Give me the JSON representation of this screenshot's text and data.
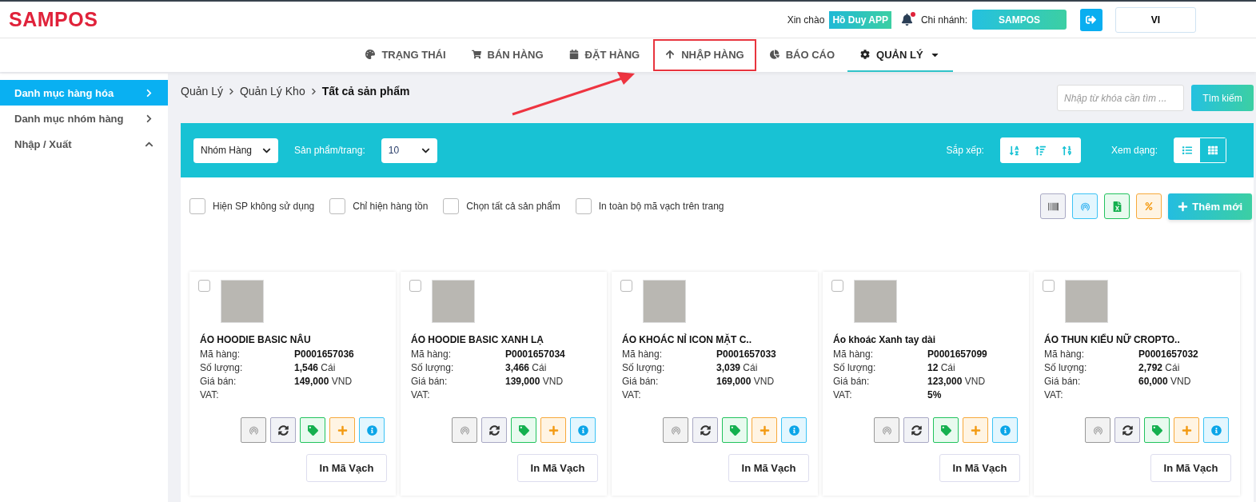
{
  "header": {
    "logo": "SAMPOS",
    "greeting": "Xin chào",
    "user": "Hồ Duy APP",
    "notifications": {
      "unread": true
    },
    "branch_label": "Chi nhánh:",
    "branch": "SAMPOS",
    "language": "VI"
  },
  "nav": [
    {
      "label": "TRẠNG THÁI",
      "selected": false,
      "highlighted": false,
      "dropdown": false
    },
    {
      "label": "BÁN HÀNG",
      "selected": false,
      "highlighted": false,
      "dropdown": false
    },
    {
      "label": "ĐẶT HÀNG",
      "selected": false,
      "highlighted": false,
      "dropdown": false
    },
    {
      "label": "NHẬP HÀNG",
      "selected": false,
      "highlighted": true,
      "dropdown": false
    },
    {
      "label": "BÁO CÁO",
      "selected": false,
      "highlighted": false,
      "dropdown": false
    },
    {
      "label": "QUẢN LÝ",
      "selected": true,
      "highlighted": false,
      "dropdown": true
    }
  ],
  "sidebar": {
    "items": [
      {
        "label": "Danh mục hàng hóa",
        "selected": true,
        "expanded": false
      },
      {
        "label": "Danh mục nhóm hàng",
        "selected": false,
        "expanded": false
      },
      {
        "label": "Nhập / Xuất",
        "selected": false,
        "expanded": true
      }
    ]
  },
  "breadcrumb": [
    "Quản Lý",
    "Quản Lý Kho",
    "Tất cả sản phẩm"
  ],
  "search": {
    "placeholder": "Nhập từ khóa cần tìm ...",
    "button": "Tìm kiếm"
  },
  "toolbar": {
    "group_select": "Nhóm Hàng",
    "per_page_label": "Sản phẩm/trang:",
    "per_page": "10",
    "sort_label": "Sắp xếp:",
    "view_label": "Xem dạng:",
    "view_modes": [
      {
        "kind": "list",
        "selected": false
      },
      {
        "kind": "grid",
        "selected": true
      }
    ]
  },
  "filters": [
    {
      "label": "Hiện SP không sử dụng",
      "checked": false
    },
    {
      "label": "Chỉ hiện hàng tồn",
      "checked": false
    },
    {
      "label": "Chọn tất cả sản phẩm",
      "checked": false
    },
    {
      "label": "In toàn bộ mã vạch trên trang",
      "checked": false
    }
  ],
  "add_button": "Thêm mới",
  "products": [
    {
      "name": "ÁO HOODIE BASIC NÂU",
      "checked": false,
      "fields": [
        {
          "label": "Mã hàng:",
          "value": "**P0001657036**"
        },
        {
          "label": "Số lượng:",
          "value": "**1,546** Cái"
        },
        {
          "label": "Giá bán:",
          "value": "**149,000** VND"
        },
        {
          "label": "VAT:"
        }
      ],
      "print": "In Mã Vạch"
    },
    {
      "name": "ÁO HOODIE BASIC XANH LẠ",
      "checked": false,
      "fields": [
        {
          "label": "Mã hàng:",
          "value": "**P0001657034**"
        },
        {
          "label": "Số lượng:",
          "value": "**3,466** Cái"
        },
        {
          "label": "Giá bán:",
          "value": "**139,000** VND"
        },
        {
          "label": "VAT:"
        }
      ],
      "print": "In Mã Vạch"
    },
    {
      "name": "ÁO KHOÁC NỈ ICON MẶT C..",
      "checked": false,
      "fields": [
        {
          "label": "Mã hàng:",
          "value": "**P0001657033**"
        },
        {
          "label": "Số lượng:",
          "value": "**3,039** Cái"
        },
        {
          "label": "Giá bán:",
          "value": "**169,000** VND"
        },
        {
          "label": "VAT:"
        }
      ],
      "print": "In Mã Vạch"
    },
    {
      "name": "Áo khoác Xanh tay dài",
      "checked": false,
      "fields": [
        {
          "label": "Mã hàng:",
          "value": "**P0001657099**"
        },
        {
          "label": "Số lượng:",
          "value": "**12** Cái"
        },
        {
          "label": "Giá bán:",
          "value": "**123,000** VND"
        },
        {
          "label": "VAT:",
          "value": "**5%**"
        }
      ],
      "print": "In Mã Vạch"
    },
    {
      "name": "ÁO THUN KIỂU NỮ CROPTO..",
      "checked": false,
      "fields": [
        {
          "label": "Mã hàng:",
          "value": "**P0001657032**"
        },
        {
          "label": "Số lượng:",
          "value": "**2,792** Cái"
        },
        {
          "label": "Giá bán:",
          "value": "**60,000** VND"
        },
        {
          "label": "VAT:"
        }
      ],
      "print": "In Mã Vạch"
    }
  ]
}
